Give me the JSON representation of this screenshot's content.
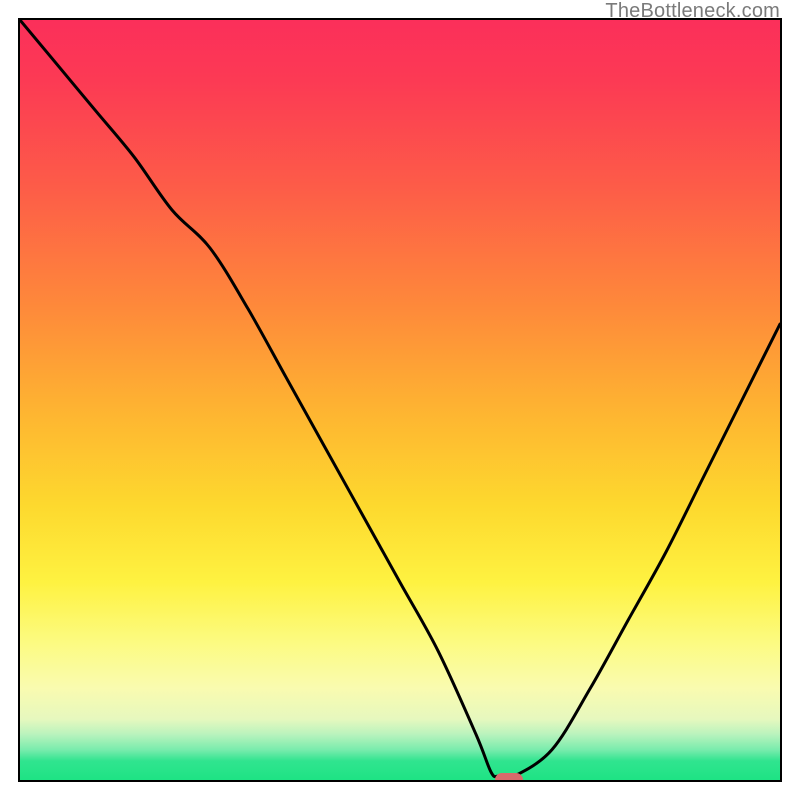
{
  "watermark": "TheBottleneck.com",
  "colors": {
    "gradient_top": "#fb2f5a",
    "gradient_bottom": "#1ee384",
    "curve": "#000000",
    "marker": "#d76a6b",
    "border": "#000000"
  },
  "chart_data": {
    "type": "line",
    "title": "",
    "xlabel": "",
    "ylabel": "",
    "xlim": [
      0,
      100
    ],
    "ylim": [
      0,
      100
    ],
    "grid": false,
    "x": [
      0,
      5,
      10,
      15,
      20,
      25,
      30,
      35,
      40,
      45,
      50,
      55,
      60,
      62,
      63,
      65,
      70,
      75,
      80,
      85,
      90,
      95,
      100
    ],
    "values": [
      100,
      94,
      88,
      82,
      75,
      70,
      62,
      53,
      44,
      35,
      26,
      17,
      6,
      1,
      0.5,
      0.5,
      4,
      12,
      21,
      30,
      40,
      50,
      60
    ],
    "marker": {
      "x": 64,
      "y": 0.5
    },
    "note": "Values approximate a bottleneck-style V curve; minimum around x≈63–65. y=0 is bottom (green), y=100 is top (red)."
  }
}
